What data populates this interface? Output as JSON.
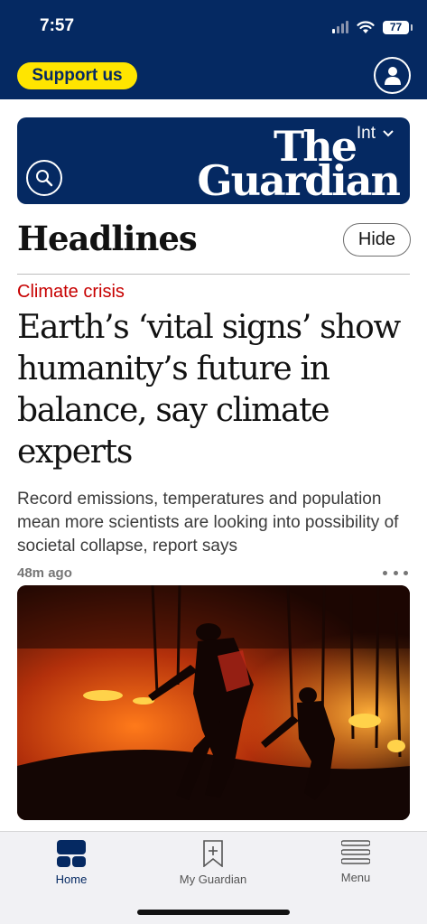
{
  "status_bar": {
    "time": "7:57",
    "battery": "77",
    "icons": [
      "signal-icon",
      "wifi-icon",
      "battery-icon"
    ]
  },
  "app_bar": {
    "support_label": "Support us",
    "profile_icon": "profile-icon"
  },
  "masthead": {
    "edition": "Int",
    "logo_line1": "The",
    "logo_line2": "Guardian",
    "search_icon": "search-icon"
  },
  "section": {
    "title": "Headlines",
    "hide_label": "Hide"
  },
  "article": {
    "kicker": "Climate crisis",
    "headline": "Earth’s ‘vital signs’ show humanity’s future in balance, say climate experts",
    "standfirst": "Record emissions, temperatures and population mean more scientists are looking into possibility of societal collapse, report says",
    "timestamp": "48m ago",
    "image_description_icon": "wildfire-photo"
  },
  "tabbar": {
    "tabs": [
      {
        "label": "Home",
        "icon": "home-icon",
        "active": true
      },
      {
        "label": "My Guardian",
        "icon": "bookmark-add-icon",
        "active": false
      },
      {
        "label": "Menu",
        "icon": "menu-icon",
        "active": false
      }
    ]
  },
  "colors": {
    "brand_navy": "#052962",
    "support_yellow": "#ffe500",
    "kicker_red": "#c70000"
  }
}
